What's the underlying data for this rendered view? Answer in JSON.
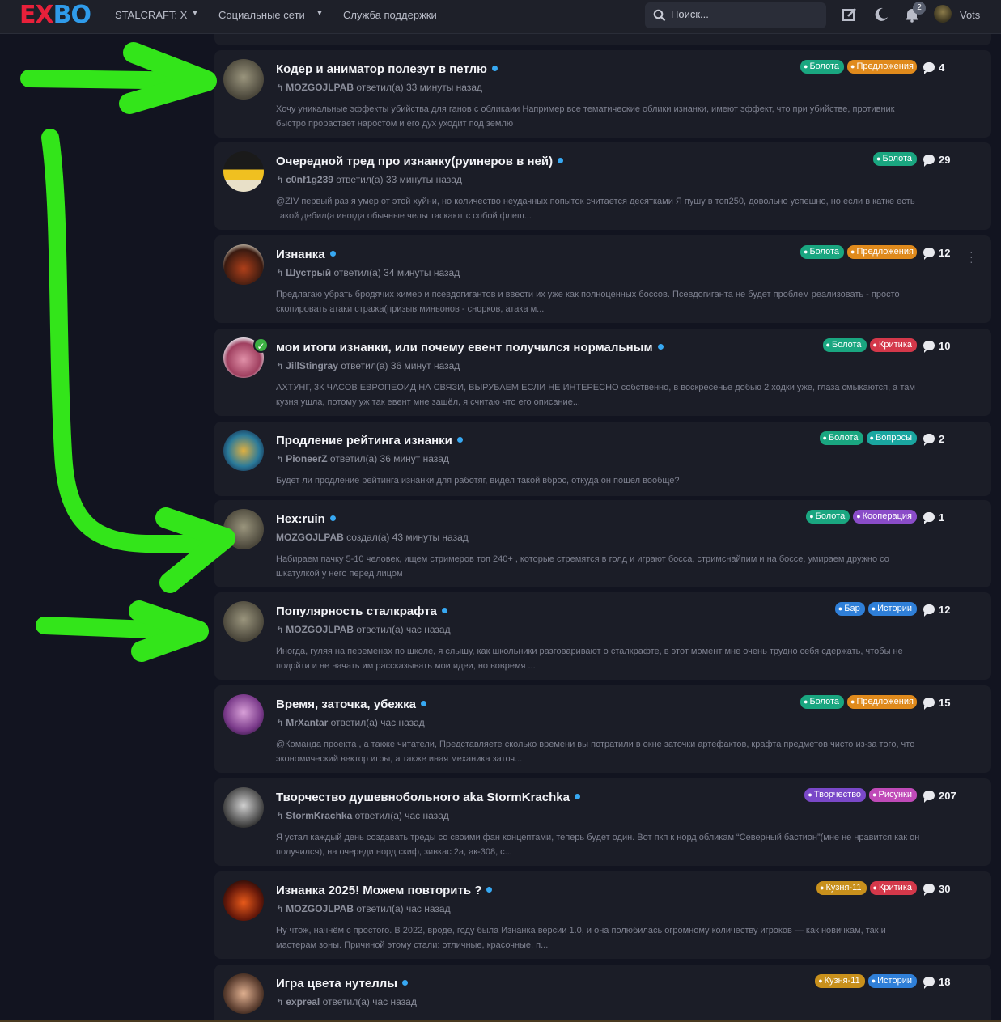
{
  "header": {
    "logo_left": "EX",
    "logo_right": "BO",
    "nav": [
      {
        "label": "STALCRAFT: X"
      },
      {
        "label": "Социальные сети"
      },
      {
        "label": "Служба поддержки"
      }
    ],
    "search_placeholder": "Поиск...",
    "notifications_count": "2",
    "username": "Vots"
  },
  "colors": {
    "background": "#121420",
    "card": "#1b1d27",
    "accent_dot": "#37a8f2",
    "annotation_arrows": "#33e51a"
  },
  "threads": [
    {
      "title": "Кодер и аниматор полезут в петлю",
      "author": "MOZGOJLPAB",
      "action": "ответил(а) 33 минуты назад",
      "excerpt": "Хочу уникальные эффекты убийства для ганов с обликаии Например все тематические облики изнанки, имеют эффект, что при убийстве, противник быстро прорастает наростом и его дух уходит под землю",
      "tags": [
        {
          "label": "Болота",
          "icon": "frog-icon"
        },
        {
          "label": "Предложения",
          "icon": "bulb-icon"
        }
      ],
      "replies": "4"
    },
    {
      "title": "Очередной тред про изнанку(руинеров в ней)",
      "author": "c0nf1g239",
      "action": "ответил(а) 33 минуты назад",
      "excerpt": "@ZIV первый раз я умер от этой хуйни, но количество неудачных попыток считается десятками Я пушу в топ250, довольно успешно, но если в катке есть такой дебил(а иногда обычные челы таскают с собой флеш...",
      "tags": [
        {
          "label": "Болота",
          "icon": "frog-icon"
        }
      ],
      "replies": "29"
    },
    {
      "title": "Изнанка",
      "author": "Шустрый",
      "action": "ответил(а) 34 минуты назад",
      "excerpt": "Предлагаю убрать бродячих химер и псевдогигантов и ввести их уже как полноценных боссов. Псевдогиганта не будет проблем реализовать - просто скопировать атаки стража(призыв миньонов - снорков, атака м...",
      "tags": [
        {
          "label": "Болота",
          "icon": "frog-icon"
        },
        {
          "label": "Предложения",
          "icon": "bulb-icon"
        }
      ],
      "replies": "12"
    },
    {
      "title": "мои итоги изнанки, или почему евент получился нормальным",
      "author": "JillStingray",
      "action": "ответил(а) 36 минут назад",
      "excerpt": "АХТУНГ, 3К ЧАСОВ ЕВРОПЕОИД НА СВЯЗИ, ВЫРУБАЕМ ЕСЛИ НЕ ИНТЕРЕСНО собственно, в воскресенье добью 2 ходки уже, глаза смыкаются, а там кузня ушла, потому уж так евент мне зашёл, я считаю что его описание...",
      "tags": [
        {
          "label": "Болота",
          "icon": "frog-icon"
        },
        {
          "label": "Критика",
          "icon": "sad-icon"
        }
      ],
      "replies": "10"
    },
    {
      "title": "Продление рейтинга изнанки",
      "author": "PioneerZ",
      "action": "ответил(а) 36 минут назад",
      "excerpt": "Будет ли продление рейтинга изнанки для работяг, видел такой вброс, откуда он пошел вообще?",
      "tags": [
        {
          "label": "Болота",
          "icon": "frog-icon"
        },
        {
          "label": "Вопросы",
          "icon": "question-icon"
        }
      ],
      "replies": "2"
    },
    {
      "title": "Hex:ruin",
      "author": "MOZGOJLPAB",
      "action": "создал(а) 43 минуты назад",
      "excerpt": "Набираем пачку 5-10 человек, ищем стримеров топ 240+ , которые стремятся в голд и играют босса, стримснайпим и на боссе, умираем дружно со шкатулкой у него перед лицом",
      "tags": [
        {
          "label": "Болота",
          "icon": "frog-icon"
        },
        {
          "label": "Кооперация",
          "icon": "handshake-icon"
        }
      ],
      "replies": "1"
    },
    {
      "title": "Популярность сталкрафта",
      "author": "MOZGOJLPAB",
      "action": "ответил(а) час назад",
      "excerpt": "Иногда, гуляя на переменах по школе, я слышу, как школьники разговаривают о сталкрафте, в этот момент мне очень трудно себя сдержать, чтобы не подойти и не начать им рассказывать мои идеи, но вовремя ...",
      "tags": [
        {
          "label": "Бар",
          "icon": "radiation-icon"
        },
        {
          "label": "Истории",
          "icon": "fire-icon"
        }
      ],
      "replies": "12"
    },
    {
      "title": "Время, заточка, убежка",
      "author": "MrXantar",
      "action": "ответил(а) час назад",
      "excerpt": "@Команда проекта , а также читатели, Представляете сколько времени вы потратили в окне заточки артефактов, крафта предметов чисто из-за того, что экономический вектор игры, а также иная механика заточ...",
      "tags": [
        {
          "label": "Болота",
          "icon": "frog-icon"
        },
        {
          "label": "Предложения",
          "icon": "bulb-icon"
        }
      ],
      "replies": "15"
    },
    {
      "title": "Творчество душевнобольного aka StormKrachka",
      "author": "StormKrachka",
      "action": "ответил(а) час назад",
      "excerpt": "Я устал каждый день создавать треды со своими фан концептами, теперь будет один. Вот пкп к норд обликам “Северный бастион”(мне не нравится как он получился), на очереди норд скиф, зивкас 2а, ак-308, с...",
      "tags": [
        {
          "label": "Творчество",
          "icon": "brush-icon"
        },
        {
          "label": "Рисунки",
          "icon": "pencil-icon"
        }
      ],
      "replies": "207"
    },
    {
      "title": "Изнанка 2025! Можем повторить ?",
      "author": "MOZGOJLPAB",
      "action": "ответил(а) час назад",
      "excerpt": "Ну чтож, начнём с простого. В 2022, вроде, году была Изнанка версии 1.0, и она полюбилась огромному количеству игроков — как новичкам, так и мастерам зоны. Причиной этому стали: отличные, красочные, п...",
      "tags": [
        {
          "label": "Кузня-11",
          "icon": "skull-icon"
        },
        {
          "label": "Критика",
          "icon": "sad-icon"
        }
      ],
      "replies": "30"
    },
    {
      "title": "Игра цвета нутеллы",
      "author": "expreal",
      "action": "ответил(а) час назад",
      "excerpt": "",
      "tags": [
        {
          "label": "Кузня-11",
          "icon": "skull-icon"
        },
        {
          "label": "Истории",
          "icon": "fire-icon"
        }
      ],
      "replies": "18"
    }
  ]
}
